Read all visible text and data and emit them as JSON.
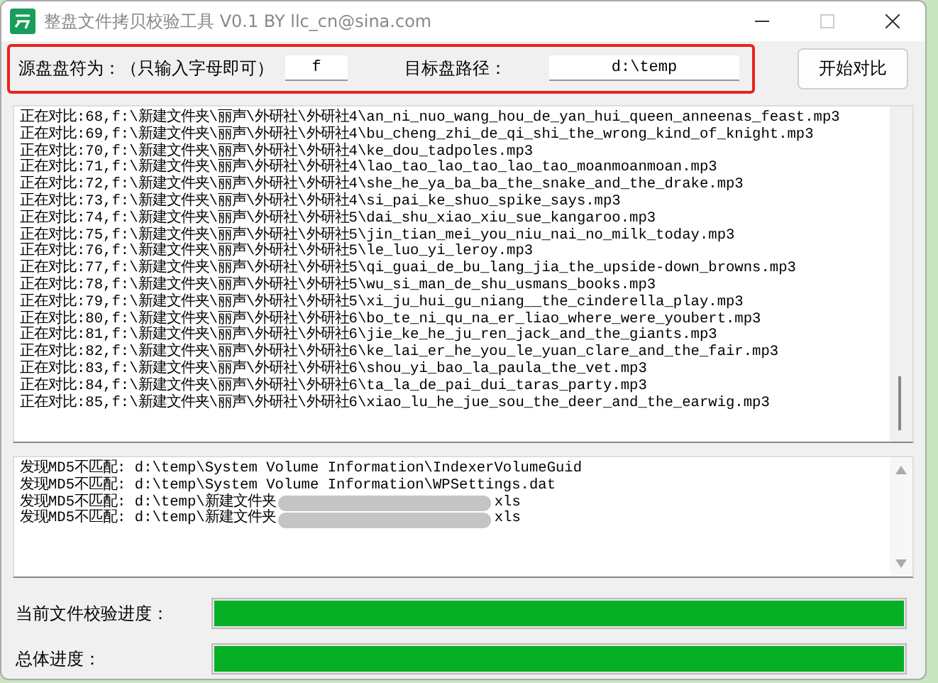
{
  "window": {
    "title": "整盘文件拷贝校验工具 V0.1 BY llc_cn@sina.com",
    "maximize_disabled": true
  },
  "source": {
    "label": "源盘盘符为：（只输入字母即可）",
    "value": "f"
  },
  "target": {
    "label": "目标盘路径：",
    "value": "d:\\temp"
  },
  "start_button": "开始对比",
  "log": [
    "正在对比:68,f:\\新建文件夹\\丽声\\外研社\\外研社4\\an_ni_nuo_wang_hou_de_yan_hui_queen_anneenas_feast.mp3",
    "正在对比:69,f:\\新建文件夹\\丽声\\外研社\\外研社4\\bu_cheng_zhi_de_qi_shi_the_wrong_kind_of_knight.mp3",
    "正在对比:70,f:\\新建文件夹\\丽声\\外研社\\外研社4\\ke_dou_tadpoles.mp3",
    "正在对比:71,f:\\新建文件夹\\丽声\\外研社\\外研社4\\lao_tao_lao_tao_lao_tao_moanmoanmoan.mp3",
    "正在对比:72,f:\\新建文件夹\\丽声\\外研社\\外研社4\\she_he_ya_ba_ba_the_snake_and_the_drake.mp3",
    "正在对比:73,f:\\新建文件夹\\丽声\\外研社\\外研社4\\si_pai_ke_shuo_spike_says.mp3",
    "正在对比:74,f:\\新建文件夹\\丽声\\外研社\\外研社5\\dai_shu_xiao_xiu_sue_kangaroo.mp3",
    "正在对比:75,f:\\新建文件夹\\丽声\\外研社\\外研社5\\jin_tian_mei_you_niu_nai_no_milk_today.mp3",
    "正在对比:76,f:\\新建文件夹\\丽声\\外研社\\外研社5\\le_luo_yi_leroy.mp3",
    "正在对比:77,f:\\新建文件夹\\丽声\\外研社\\外研社5\\qi_guai_de_bu_lang_jia_the_upside-down_browns.mp3",
    "正在对比:78,f:\\新建文件夹\\丽声\\外研社\\外研社5\\wu_si_man_de_shu_usmans_books.mp3",
    "正在对比:79,f:\\新建文件夹\\丽声\\外研社\\外研社5\\xi_ju_hui_gu_niang__the_cinderella_play.mp3",
    "正在对比:80,f:\\新建文件夹\\丽声\\外研社\\外研社6\\bo_te_ni_qu_na_er_liao_where_were_youbert.mp3",
    "正在对比:81,f:\\新建文件夹\\丽声\\外研社\\外研社6\\jie_ke_he_ju_ren_jack_and_the_giants.mp3",
    "正在对比:82,f:\\新建文件夹\\丽声\\外研社\\外研社6\\ke_lai_er_he_you_le_yuan_clare_and_the_fair.mp3",
    "正在对比:83,f:\\新建文件夹\\丽声\\外研社\\外研社6\\shou_yi_bao_la_paula_the_vet.mp3",
    "正在对比:84,f:\\新建文件夹\\丽声\\外研社\\外研社6\\ta_la_de_pai_dui_taras_party.mp3",
    "正在对比:85,f:\\新建文件夹\\丽声\\外研社\\外研社6\\xiao_lu_he_jue_sou_the_deer_and_the_earwig.mp3"
  ],
  "mismatches": [
    {
      "text": "发现MD5不匹配: d:\\temp\\System Volume Information\\IndexerVolumeGuid",
      "hidden": false
    },
    {
      "text": "发现MD5不匹配: d:\\temp\\System Volume Information\\WPSettings.dat",
      "hidden": false
    },
    {
      "text": "发现MD5不匹配: d:\\temp\\新建文件夹",
      "hidden": true,
      "tail": "xls"
    },
    {
      "text": "发现MD5不匹配: d:\\temp\\新建文件夹",
      "hidden": true,
      "tail": "xls"
    }
  ],
  "progress": [
    {
      "label": "当前文件校验进度：",
      "level": 1
    },
    {
      "label": "总体进度：",
      "level": 1
    }
  ]
}
